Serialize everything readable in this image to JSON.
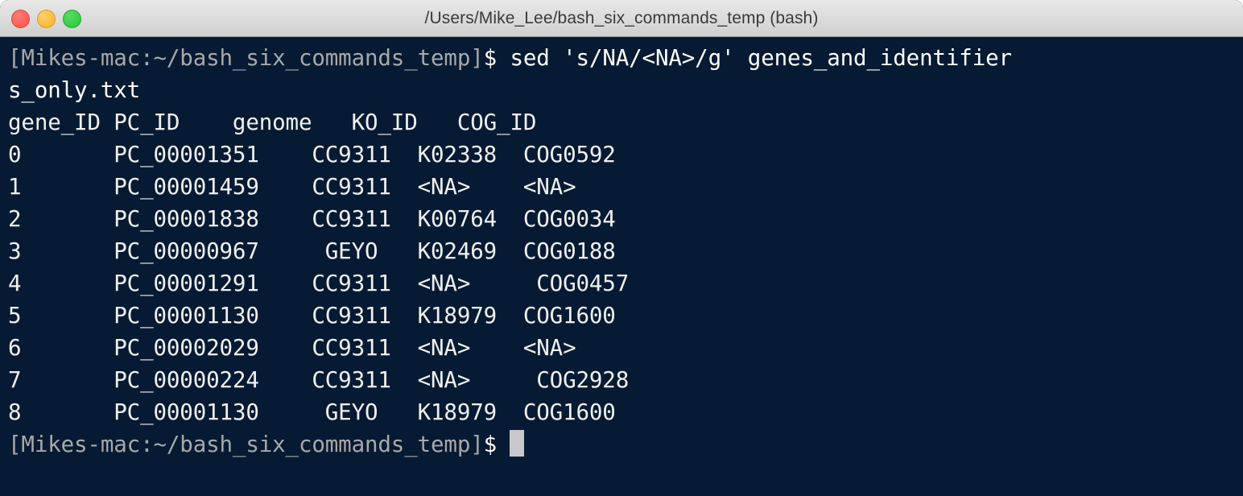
{
  "window": {
    "title": "/Users/Mike_Lee/bash_six_commands_temp (bash)",
    "controls": {
      "close_label": "",
      "minimize_label": "",
      "maximize_label": ""
    },
    "colors": {
      "titlebar_bg": "#dcdcdc",
      "terminal_bg": "#061a33",
      "text": "#f2f2f2",
      "prompt_text": "#a8a8a8",
      "cursor": "#c8c8cc",
      "close_button": "#f9534b",
      "minimize_button": "#f7b029",
      "maximize_button": "#27c53a"
    }
  },
  "terminal": {
    "prompt_string": "[Mikes-mac:~/bash_six_commands_temp]",
    "dollar": "$",
    "command": " sed 's/NA/<NA>/g' genes_and_identifier",
    "command_wrap": "s_only.txt",
    "full_command": "sed 's/NA/<NA>/g' genes_and_identifiers_only.txt",
    "output_lines": [
      "gene_ID PC_ID    genome   KO_ID   COG_ID",
      "0       PC_00001351    CC9311  K02338  COG0592",
      "1       PC_00001459    CC9311  <NA>    <NA>",
      "2       PC_00001838    CC9311  K00764  COG0034",
      "3       PC_00000967     GEYO   K02469  COG0188",
      "4       PC_00001291    CC9311  <NA>     COG0457",
      "5       PC_00001130    CC9311  K18979  COG1600",
      "6       PC_00002029    CC9311  <NA>    <NA>",
      "7       PC_00000224    CC9311  <NA>     COG2928",
      "8       PC_00001130     GEYO   K18979  COG1600"
    ],
    "final_prompt_string": "[Mikes-mac:~/bash_six_commands_temp]",
    "final_dollar": "$",
    "cursor_visible": true,
    "table": {
      "headers": [
        "gene_ID",
        "PC_ID",
        "genome",
        "KO_ID",
        "COG_ID"
      ],
      "rows": [
        [
          "0",
          "PC_00001351",
          "CC9311",
          "K02338",
          "COG0592"
        ],
        [
          "1",
          "PC_00001459",
          "CC9311",
          "<NA>",
          "<NA>"
        ],
        [
          "2",
          "PC_00001838",
          "CC9311",
          "K00764",
          "COG0034"
        ],
        [
          "3",
          "PC_00000967",
          "GEYO",
          "K02469",
          "COG0188"
        ],
        [
          "4",
          "PC_00001291",
          "CC9311",
          "<NA>",
          "COG0457"
        ],
        [
          "5",
          "PC_00001130",
          "CC9311",
          "K18979",
          "COG1600"
        ],
        [
          "6",
          "PC_00002029",
          "CC9311",
          "<NA>",
          "<NA>"
        ],
        [
          "7",
          "PC_00000224",
          "CC9311",
          "<NA>",
          "COG2928"
        ],
        [
          "8",
          "PC_00001130",
          "GEYO",
          "K18979",
          "COG1600"
        ]
      ]
    }
  }
}
